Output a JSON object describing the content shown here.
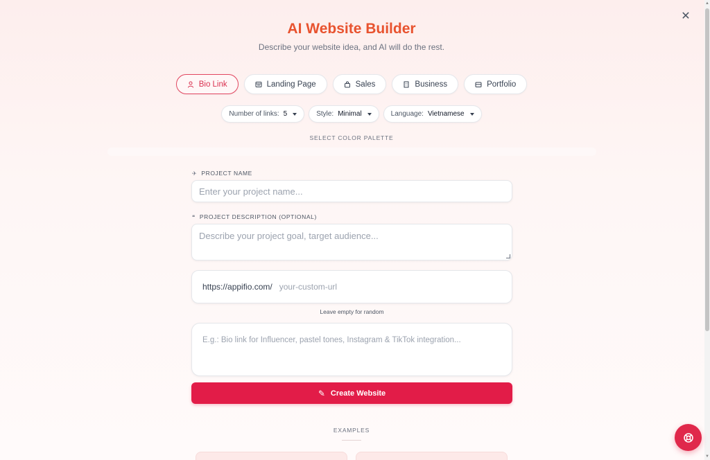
{
  "header": {
    "title": "AI Website Builder",
    "subtitle": "Describe your website idea, and AI will do the rest."
  },
  "types": [
    {
      "label": "Bio Link",
      "icon": "user-icon",
      "active": true
    },
    {
      "label": "Landing Page",
      "icon": "layout-icon",
      "active": false
    },
    {
      "label": "Sales",
      "icon": "bag-icon",
      "active": false
    },
    {
      "label": "Business",
      "icon": "building-icon",
      "active": false
    },
    {
      "label": "Portfolio",
      "icon": "portfolio-icon",
      "active": false
    }
  ],
  "options": {
    "links": {
      "label": "Number of links:",
      "value": "5"
    },
    "style": {
      "label": "Style:",
      "value": "Minimal"
    },
    "language": {
      "label": "Language:",
      "value": "Vietnamese"
    }
  },
  "palette": {
    "label": "SELECT COLOR PALETTE"
  },
  "project_name": {
    "label": "PROJECT NAME",
    "placeholder": "Enter your project name..."
  },
  "project_description": {
    "label": "PROJECT DESCRIPTION (OPTIONAL)",
    "placeholder": "Describe your project goal, target audience..."
  },
  "url": {
    "prefix": "https://appifio.com/",
    "placeholder": "your-custom-url",
    "hint": "Leave empty for random"
  },
  "prompt": {
    "placeholder": "E.g.: Bio link for Influencer, pastel tones, Instagram & TikTok integration..."
  },
  "create_button": {
    "label": "Create Website"
  },
  "examples": {
    "label": "EXAMPLES"
  },
  "colors": {
    "accent": "#e21c48",
    "title": "#e8532f"
  }
}
